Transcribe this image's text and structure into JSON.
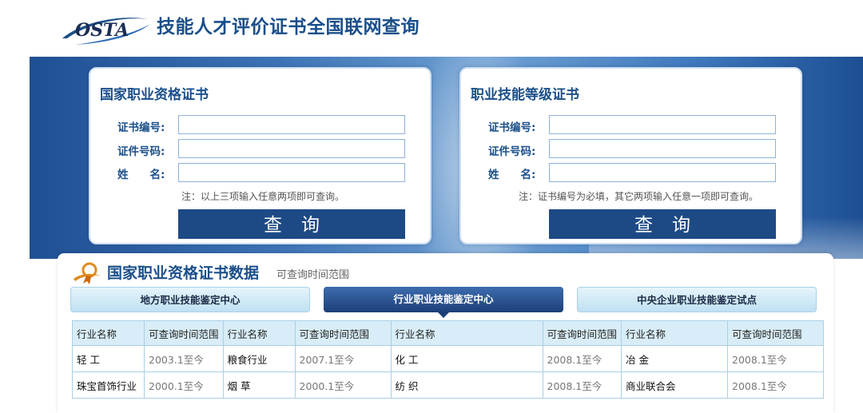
{
  "header": {
    "logo_text": "OSTA",
    "title": "技能人才评价证书全国联网查询"
  },
  "colors": {
    "brand_blue": "#1b4f8a",
    "button_blue": "#1d4a85",
    "banner_blue": "#3d74b6",
    "table_header_bg": "#d8edf7"
  },
  "cards": [
    {
      "title": "国家职业资格证书",
      "fields": [
        {
          "label": "证书编号:",
          "value": "",
          "placeholder": ""
        },
        {
          "label": "证件号码:",
          "value": "",
          "placeholder": ""
        },
        {
          "label": "姓　　名:",
          "value": "",
          "placeholder": ""
        }
      ],
      "note": "注：以上三项输入任意两项即可查询。",
      "button_label": "查询"
    },
    {
      "title": "职业技能等级证书",
      "fields": [
        {
          "label": "证书编号:",
          "value": "",
          "placeholder": ""
        },
        {
          "label": "证件号码:",
          "value": "",
          "placeholder": ""
        },
        {
          "label": "姓　　名:",
          "value": "",
          "placeholder": ""
        }
      ],
      "note": "注：证书编号为必填，其它两项输入任意一项即可查询。",
      "button_label": "查询"
    }
  ],
  "data_panel": {
    "title": "国家职业资格证书数据",
    "subtitle": "可查询时间范围",
    "emblem_icon": "certificate-ribbon-icon",
    "tabs": [
      {
        "label": "地方职业技能鉴定中心",
        "active": false
      },
      {
        "label": "行业职业技能鉴定中心",
        "active": true
      },
      {
        "label": "中央企业职业技能鉴定试点",
        "active": false
      }
    ],
    "table": {
      "headers": [
        "行业名称",
        "可查询时间范围",
        "行业名称",
        "可查询时间范围",
        "行业名称",
        "可查询时间范围",
        "行业名称",
        "可查询时间范围"
      ],
      "rows": [
        [
          "轻 工",
          "2003.1至今",
          "粮食行业",
          "2007.1至今",
          "化 工",
          "2008.1至今",
          "冶 金",
          "2008.1至今"
        ],
        [
          "珠宝首饰行业",
          "2000.1至今",
          "烟 草",
          "2000.1至今",
          "纺 织",
          "2008.1至今",
          "商业联合会",
          "2008.1至今"
        ]
      ]
    }
  }
}
